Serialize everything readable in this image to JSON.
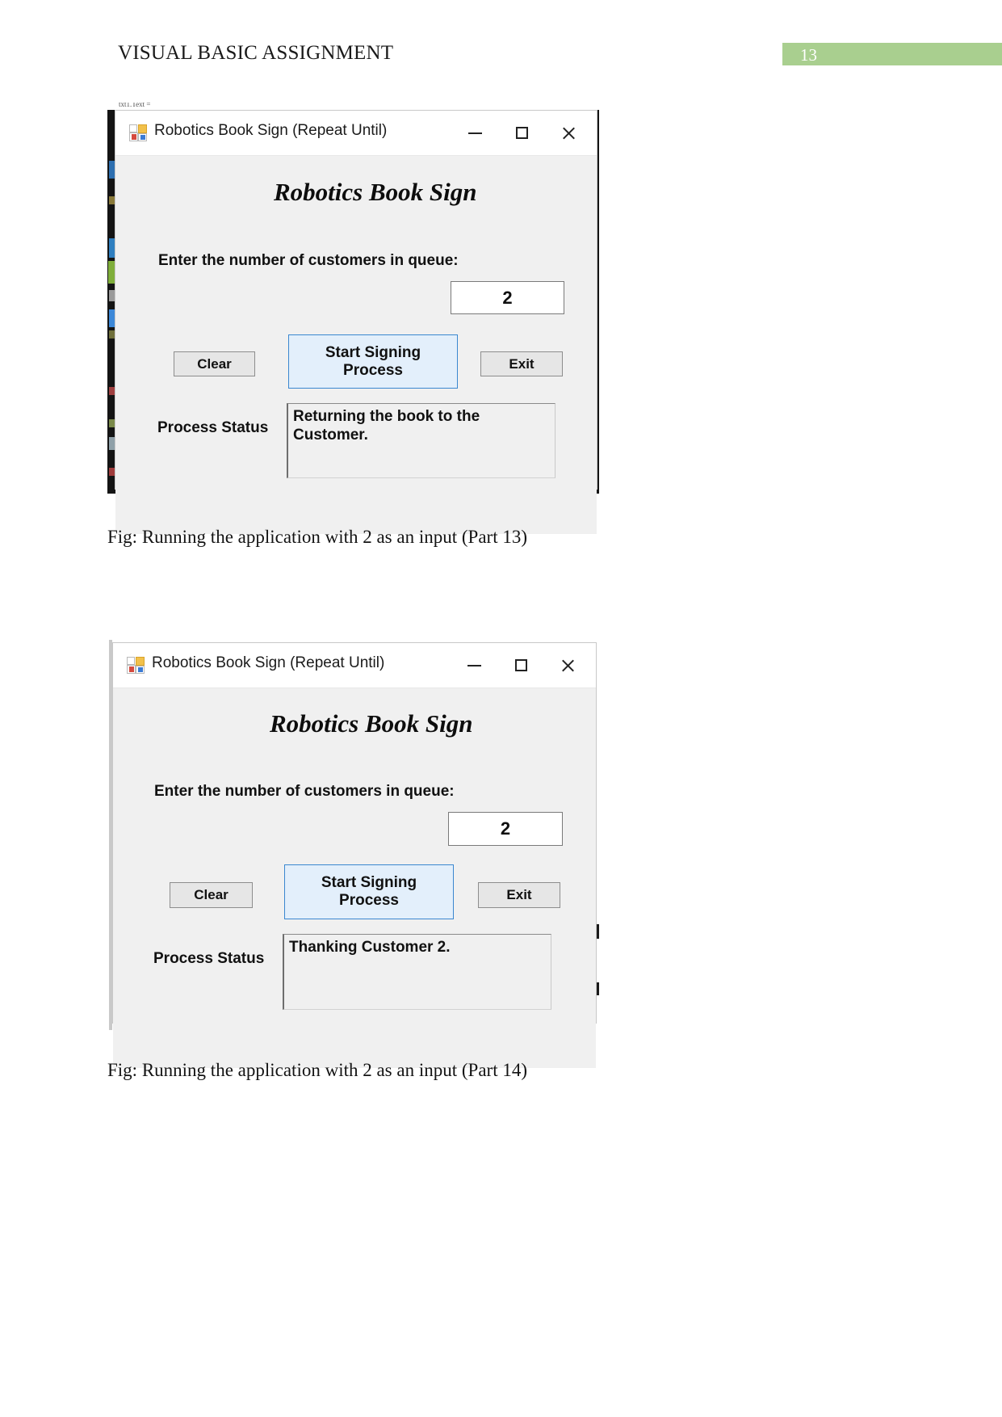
{
  "header": {
    "title": "VISUAL BASIC ASSIGNMENT",
    "page_number": "13",
    "badge_color": "#a9cf8f"
  },
  "figures": [
    {
      "window": {
        "title": "Robotics Book Sign (Repeat Until)",
        "icon": "vb-winform-icon",
        "controls": {
          "minimize": "minimize-icon",
          "maximize": "maximize-icon",
          "close": "close-icon"
        },
        "form": {
          "heading": "Robotics Book Sign",
          "prompt_label": "Enter the number of customers in queue:",
          "input_value": "2",
          "buttons": {
            "clear": "Clear",
            "start": "Start Signing\nProcess",
            "start_line1": "Start Signing",
            "start_line2": "Process",
            "exit": "Exit"
          },
          "status_label": "Process Status",
          "status_line1": "Returning the book to the",
          "status_line2": "Customer."
        }
      },
      "caption": "Fig: Running the application with 2 as an input (Part 13)"
    },
    {
      "window": {
        "title": "Robotics Book Sign (Repeat Until)",
        "icon": "vb-winform-icon",
        "controls": {
          "minimize": "minimize-icon",
          "maximize": "maximize-icon",
          "close": "close-icon"
        },
        "form": {
          "heading": "Robotics Book Sign",
          "prompt_label": "Enter the number of customers in queue:",
          "input_value": "2",
          "buttons": {
            "clear": "Clear",
            "start_line1": "Start Signing",
            "start_line2": "Process",
            "exit": "Exit"
          },
          "status_label": "Process Status",
          "status_line1": "Thanking Customer 2.",
          "status_line2": ""
        }
      },
      "caption": "Fig: Running the application with 2 as an input (Part 14)"
    }
  ]
}
